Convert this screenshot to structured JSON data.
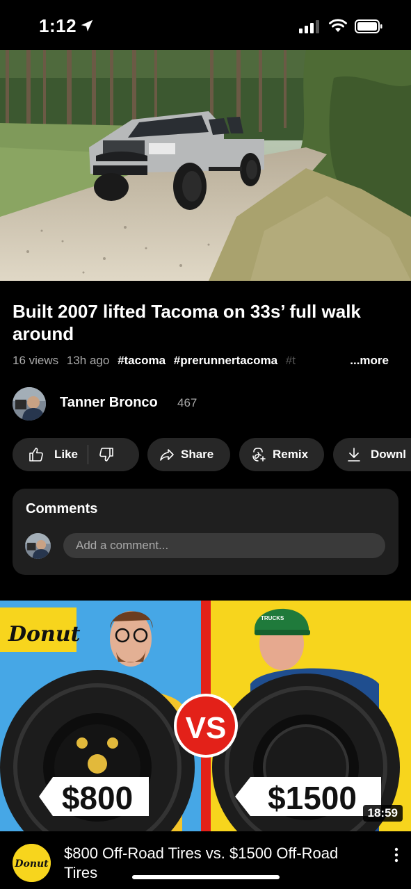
{
  "status_bar": {
    "time": "1:12"
  },
  "video": {
    "title": "Built 2007 lifted Tacoma on 33s’ full walk around",
    "views": "16 views",
    "age": "13h ago",
    "tags": [
      "#tacoma",
      "#prerunnertacoma",
      "#t"
    ],
    "more_label": "...more"
  },
  "channel": {
    "name": "Tanner Bronco",
    "subscribers": "467"
  },
  "actions": {
    "like_label": "Like",
    "share_label": "Share",
    "remix_label": "Remix",
    "download_label": "Downl"
  },
  "comments": {
    "title": "Comments",
    "input_placeholder": "Add a comment..."
  },
  "next_video": {
    "title": "$800 Off-Road Tires vs. $1500 Off-Road Tires",
    "duration": "18:59",
    "thumbnail": {
      "brand": "Donut",
      "left_price": "$800",
      "right_price": "$1500",
      "vs": "VS",
      "hat_text": "TRUCKS"
    }
  },
  "colors": {
    "background": "#000000",
    "pill": "#272727",
    "card": "#1f1f1f",
    "input": "#3a3a3a",
    "thumb_blue": "#46a7e6",
    "thumb_yellow": "#f7d51d",
    "thumb_red": "#e32119"
  }
}
